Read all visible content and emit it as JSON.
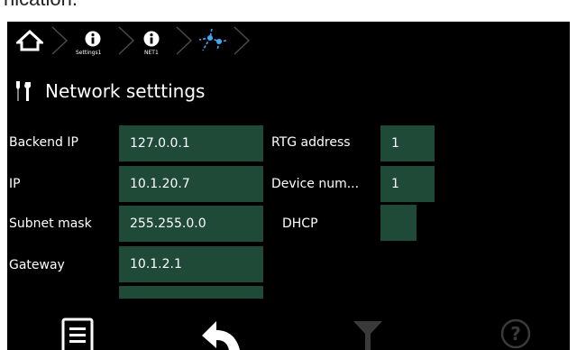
{
  "page": {
    "top_fragment": "nication."
  },
  "breadcrumb": {
    "home": "home-icon",
    "items": [
      {
        "label": "Settings1",
        "icon": "info-icon"
      },
      {
        "label": "NET1",
        "icon": "info-icon"
      },
      {
        "label": "",
        "icon": "network-topology-icon"
      }
    ]
  },
  "header": {
    "title": "Network setttings",
    "icon": "tools-icon"
  },
  "form": {
    "backend_ip": {
      "label": "Backend IP",
      "value": "127.0.0.1"
    },
    "ip": {
      "label": "IP",
      "value": "10.1.20.7"
    },
    "subnet_mask": {
      "label": "Subnet mask",
      "value": "255.255.0.0"
    },
    "gateway": {
      "label": "Gateway",
      "value": "10.1.2.1"
    },
    "rtg_address": {
      "label": "RTG address",
      "value": "1"
    },
    "device_number": {
      "label": "Device num...",
      "value": "1"
    },
    "dhcp": {
      "label": "DHCP"
    }
  },
  "footer": {
    "buttons": [
      "menu-icon",
      "back-icon",
      "filter-icon",
      "help-icon"
    ]
  },
  "colors": {
    "background": "#000000",
    "field": "#1f4a38",
    "accent": "#3fa9f5",
    "text": "#ffffff",
    "disabled": "#3a3a3a"
  }
}
